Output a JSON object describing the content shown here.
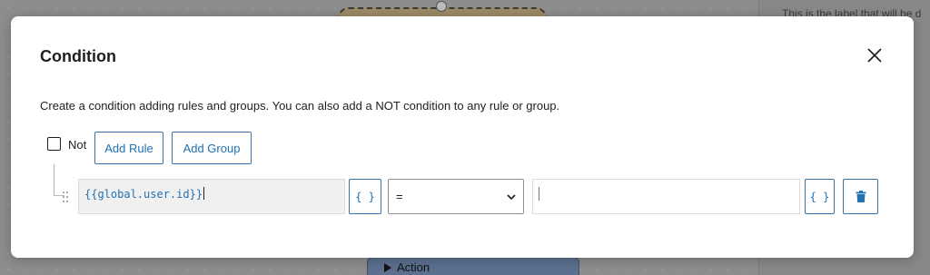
{
  "background": {
    "right_panel_label": "This is the label that will be d",
    "action_node_label": "Action"
  },
  "modal": {
    "title": "Condition",
    "description": "Create a condition adding rules and groups. You can also add a NOT condition to any rule or group.",
    "not_label": "Not",
    "not_checked": false,
    "add_rule_label": "Add Rule",
    "add_group_label": "Add Group",
    "rule": {
      "lhs_open": "{{",
      "lhs_var": "global.user.id",
      "lhs_close": "}}",
      "braces_label": "{ }",
      "operator": "=",
      "rhs_value": "",
      "braces_label_2": "{ }"
    }
  },
  "icons": {
    "close": "close-icon",
    "chevron": "chevron-down-icon",
    "trash": "trash-icon",
    "drag": "drag-handle-icon",
    "play": "play-triangle-icon"
  },
  "colors": {
    "accent": "#2271b1",
    "text": "#1e1e1e"
  }
}
